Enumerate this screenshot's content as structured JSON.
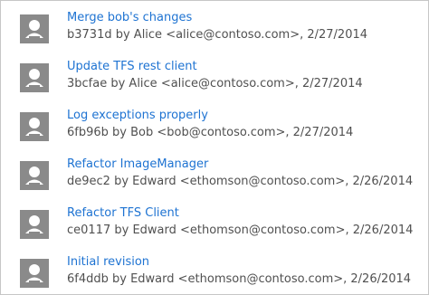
{
  "commits": [
    {
      "title": "Merge bob's changes",
      "meta": "b3731d by Alice <alice@contoso.com>, 2/27/2014"
    },
    {
      "title": "Update TFS rest client",
      "meta": "3bcfae by Alice <alice@contoso.com>, 2/27/2014"
    },
    {
      "title": "Log exceptions properly",
      "meta": "6fb96b by Bob <bob@contoso.com>, 2/27/2014"
    },
    {
      "title": "Refactor ImageManager",
      "meta": "de9ec2 by Edward <ethomson@contoso.com>, 2/26/2014"
    },
    {
      "title": "Refactor TFS Client",
      "meta": "ce0117 by Edward <ethomson@contoso.com>, 2/26/2014"
    },
    {
      "title": "Initial revision",
      "meta": "6f4ddb by Edward <ethomson@contoso.com>, 2/26/2014"
    }
  ],
  "avatar_icon": "default-user-icon"
}
